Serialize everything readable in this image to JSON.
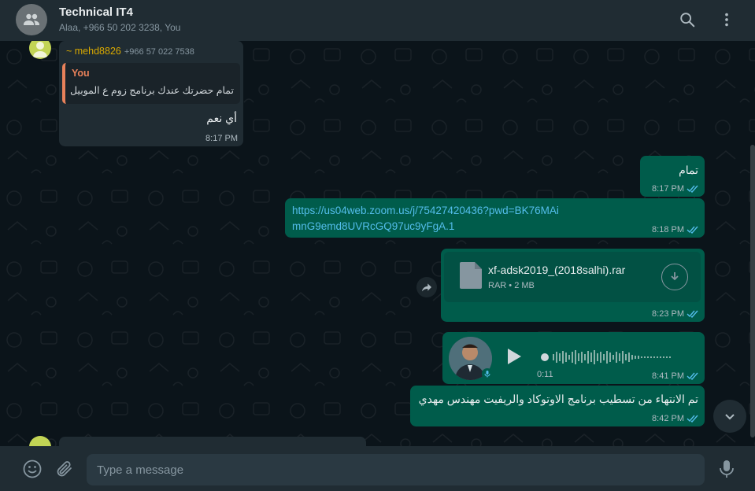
{
  "header": {
    "title": "Technical IT4",
    "subtitle": "Alaa, +966 50 202 3238, You",
    "search_icon": "search-icon",
    "menu_icon": "kebab-menu-icon"
  },
  "colors": {
    "header_bg": "#202c33",
    "chat_bg": "#0b141a",
    "incoming_bubble": "#202c33",
    "outgoing_bubble": "#005c4b",
    "link": "#53bdeb",
    "read_tick": "#53bdeb",
    "sender_name": "#d9a900",
    "quote_accent": "#e8815a"
  },
  "messages": {
    "m1": {
      "sender_name": "~ mehd8826",
      "sender_phone": "+966 57 022 7538",
      "quoted_author": "You",
      "quoted_text": "تمام حضرتك عندك برنامج زوم ع الموبيل",
      "text": "أي نعم",
      "time": "8:17 PM"
    },
    "m2": {
      "text": "تمام",
      "time": "8:17 PM"
    },
    "m3": {
      "text": "https://us04web.zoom.us/j/75427420436?pwd=BK76MAimnG9emd8UVRcGQ97uc9yFgA.1",
      "time": "8:18 PM"
    },
    "m4": {
      "file_name": "xf-adsk2019_(2018salhi).rar",
      "file_meta": "RAR • 2 MB",
      "time": "8:23 PM"
    },
    "m5": {
      "duration": "0:11",
      "time": "8:41 PM"
    },
    "m6": {
      "text": "تم الانتهاء من تسطيب برنامج الاوتوكاد والريفيت مهندس مهدي",
      "time": "8:42 PM"
    }
  },
  "composer": {
    "placeholder": "Type a message",
    "value": ""
  }
}
